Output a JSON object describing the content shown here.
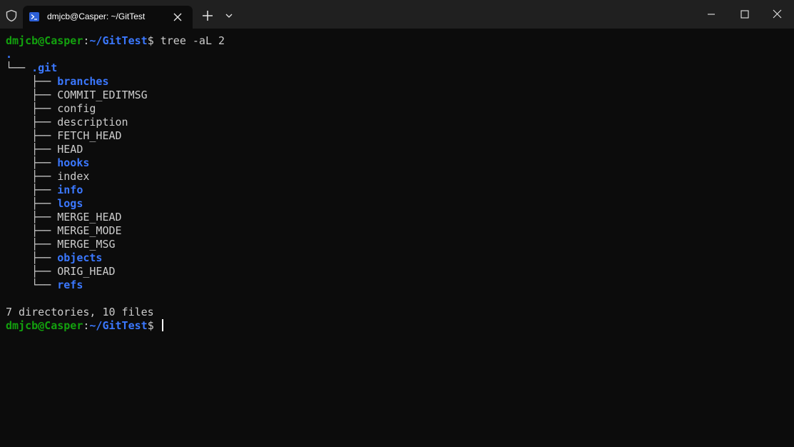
{
  "tab": {
    "title": "dmjcb@Casper: ~/GitTest"
  },
  "prompt": {
    "user_host": "dmjcb@Casper",
    "separator": ":",
    "path": "~/GitTest",
    "symbol": "$"
  },
  "command": "tree -aL 2",
  "tree": {
    "root": ".",
    "git_dir": ".git",
    "entries": [
      {
        "name": "branches",
        "type": "dir"
      },
      {
        "name": "COMMIT_EDITMSG",
        "type": "file"
      },
      {
        "name": "config",
        "type": "file"
      },
      {
        "name": "description",
        "type": "file"
      },
      {
        "name": "FETCH_HEAD",
        "type": "file"
      },
      {
        "name": "HEAD",
        "type": "file"
      },
      {
        "name": "hooks",
        "type": "dir"
      },
      {
        "name": "index",
        "type": "file"
      },
      {
        "name": "info",
        "type": "dir"
      },
      {
        "name": "logs",
        "type": "dir"
      },
      {
        "name": "MERGE_HEAD",
        "type": "file"
      },
      {
        "name": "MERGE_MODE",
        "type": "file"
      },
      {
        "name": "MERGE_MSG",
        "type": "file"
      },
      {
        "name": "objects",
        "type": "dir"
      },
      {
        "name": "ORIG_HEAD",
        "type": "file"
      },
      {
        "name": "refs",
        "type": "dir"
      }
    ]
  },
  "summary": "7 directories, 10 files",
  "colors": {
    "background": "#0c0c0c",
    "titlebar": "#202020",
    "prompt_user": "#13a10e",
    "prompt_path": "#3b78ff",
    "directory": "#3b78ff",
    "text": "#cccccc"
  }
}
